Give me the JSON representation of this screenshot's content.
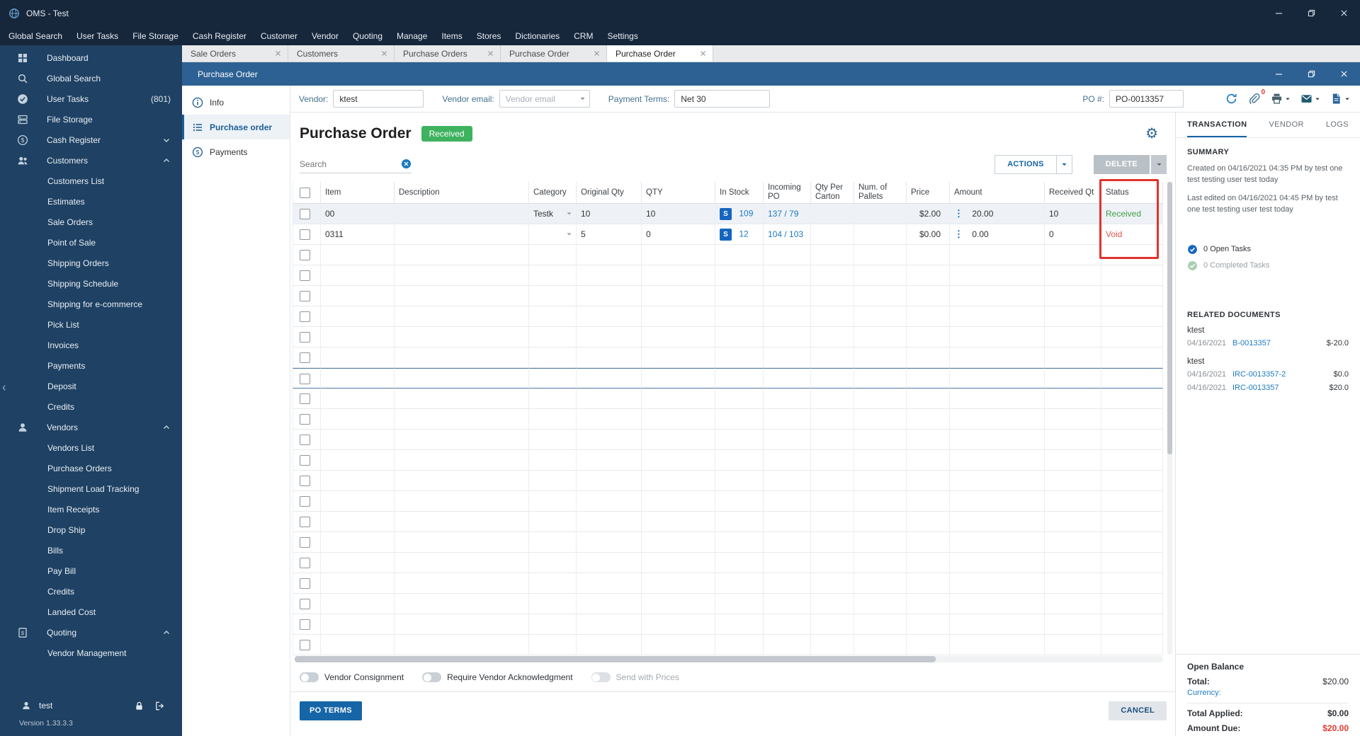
{
  "window": {
    "title": "OMS - Test"
  },
  "menu": {
    "items": [
      "Global Search",
      "User Tasks",
      "File Storage",
      "Cash Register",
      "Customer",
      "Vendor",
      "Quoting",
      "Manage",
      "Items",
      "Stores",
      "Dictionaries",
      "CRM",
      "Settings"
    ]
  },
  "tabs": [
    {
      "label": "Sale Orders"
    },
    {
      "label": "Customers"
    },
    {
      "label": "Purchase Orders"
    },
    {
      "label": "Purchase Order"
    },
    {
      "label": "Purchase Order",
      "active": true
    }
  ],
  "sidebar": {
    "items": [
      {
        "label": "Dashboard",
        "icon": "dashboard"
      },
      {
        "label": "Global Search",
        "icon": "search"
      },
      {
        "label": "User Tasks",
        "icon": "check-circle",
        "badge": "(801)"
      },
      {
        "label": "File Storage",
        "icon": "storage"
      },
      {
        "label": "Cash Register",
        "icon": "cash",
        "chevron": "chevron-down"
      },
      {
        "label": "Customers",
        "icon": "users",
        "chevron": "chevron-up"
      },
      {
        "label": "Customers List",
        "indent": true
      },
      {
        "label": "Estimates",
        "indent": true
      },
      {
        "label": "Sale Orders",
        "indent": true
      },
      {
        "label": "Point of Sale",
        "indent": true
      },
      {
        "label": "Shipping Orders",
        "indent": true
      },
      {
        "label": "Shipping Schedule",
        "indent": true
      },
      {
        "label": "Shipping for e-commerce",
        "indent": true
      },
      {
        "label": "Pick List",
        "indent": true
      },
      {
        "label": "Invoices",
        "indent": true
      },
      {
        "label": "Payments",
        "indent": true
      },
      {
        "label": "Deposit",
        "indent": true
      },
      {
        "label": "Credits",
        "indent": true
      },
      {
        "label": "Vendors",
        "icon": "person",
        "chevron": "chevron-up"
      },
      {
        "label": "Vendors List",
        "indent": true
      },
      {
        "label": "Purchase Orders",
        "indent": true
      },
      {
        "label": "Shipment Load Tracking",
        "indent": true
      },
      {
        "label": "Item Receipts",
        "indent": true
      },
      {
        "label": "Drop Ship",
        "indent": true
      },
      {
        "label": "Bills",
        "indent": true
      },
      {
        "label": "Pay Bill",
        "indent": true
      },
      {
        "label": "Credits",
        "indent": true
      },
      {
        "label": "Landed Cost",
        "indent": true
      },
      {
        "label": "Quoting",
        "icon": "quote",
        "chevron": "chevron-up"
      },
      {
        "label": "Vendor Management",
        "indent": true
      }
    ],
    "user": "test",
    "version": "Version 1.33.3.3"
  },
  "po_window": {
    "title": "Purchase Order",
    "toolbar": {
      "vendor_label": "Vendor:",
      "vendor_value": "ktest",
      "email_label": "Vendor email:",
      "email_placeholder": "Vendor email",
      "terms_label": "Payment Terms:",
      "terms_value": "Net 30",
      "po_label": "PO #:",
      "po_value": "PO-0013357",
      "attach_count": "0"
    },
    "nav": [
      {
        "label": "Info",
        "icon": "info"
      },
      {
        "label": "Purchase order",
        "icon": "list",
        "active": true
      },
      {
        "label": "Payments",
        "icon": "payments"
      }
    ],
    "page_title": "Purchase Order",
    "status_badge": "Received",
    "search_placeholder": "Search",
    "actions_label": "ACTIONS",
    "delete_label": "DELETE",
    "toggles": [
      {
        "label": "Vendor Consignment"
      },
      {
        "label": "Require Vendor Acknowledgment"
      },
      {
        "label": "Send with Prices",
        "disabled": true
      }
    ],
    "po_terms_label": "PO TERMS",
    "cancel_label": "CANCEL"
  },
  "table": {
    "s_badge": "S",
    "headers": [
      "Item",
      "Description",
      "Category",
      "Original Qty",
      "QTY",
      "In Stock",
      "Incoming PO",
      "Qty Per Carton",
      "Num. of Pallets",
      "Price",
      "Amount",
      "Received Qt",
      "Status"
    ],
    "rows": [
      {
        "item": "00",
        "description": "",
        "category": "Testk",
        "original_qty": "10",
        "qty": "10",
        "in_stock": "109",
        "incoming_po": "137 / 79",
        "qty_per_carton": "",
        "num_pallets": "",
        "price": "$2.00",
        "amount": "20.00",
        "received_qty": "10",
        "status": "Received",
        "status_color": "green",
        "selected": true
      },
      {
        "item": "0311",
        "description": "",
        "category": "",
        "original_qty": "5",
        "qty": "0",
        "in_stock": "12",
        "incoming_po": "104 / 103",
        "qty_per_carton": "",
        "num_pallets": "",
        "price": "$0.00",
        "amount": "0.00",
        "received_qty": "0",
        "status": "Void",
        "status_color": "red"
      }
    ],
    "empty_row_count": 20
  },
  "panel": {
    "tabs": [
      {
        "label": "TRANSACTION",
        "active": true
      },
      {
        "label": "VENDOR"
      },
      {
        "label": "LOGS"
      }
    ],
    "summary_title": "SUMMARY",
    "created": "Created on 04/16/2021 04:35 PM by test one test testing user test today",
    "last_edited": "Last edited on 04/16/2021 04:45 PM by test one test testing user test today",
    "open_tasks": "0 Open Tasks",
    "completed_tasks": "0 Completed Tasks",
    "related_title": "RELATED DOCUMENTS",
    "related_groups": [
      {
        "name": "ktest",
        "docs": [
          {
            "date": "04/16/2021",
            "ref": "B-0013357",
            "amount": "$-20.0"
          }
        ]
      },
      {
        "name": "ktest",
        "docs": [
          {
            "date": "04/16/2021",
            "ref": "IRC-0013357-2",
            "amount": "$0.0"
          },
          {
            "date": "04/16/2021",
            "ref": "IRC-0013357",
            "amount": "$20.0"
          }
        ]
      }
    ],
    "open_balance_title": "Open Balance",
    "total_label": "Total:",
    "total_value": "$20.00",
    "currency_label": "Currency:",
    "applied_label": "Total Applied:",
    "applied_value": "$0.00",
    "due_label": "Amount Due:",
    "due_value": "$20.00"
  },
  "colors": {
    "accent": "#1565a7",
    "link": "#1e7ac0",
    "badge_green": "#3eb25f",
    "status_green": "#43a047",
    "void_red": "#e2574c",
    "due_red": "#e5392f",
    "annotation_red": "#e0332c"
  }
}
